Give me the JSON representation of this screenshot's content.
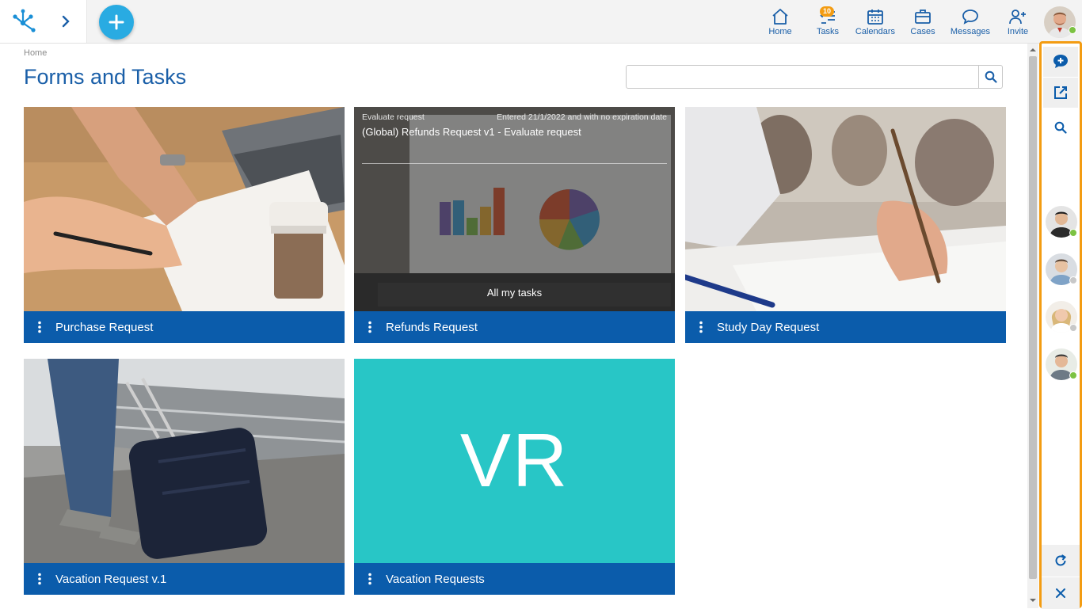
{
  "topbar": {
    "nav": [
      {
        "label": "Home",
        "icon": "home-icon"
      },
      {
        "label": "Tasks",
        "icon": "tasks-icon",
        "badge": "10"
      },
      {
        "label": "Calendars",
        "icon": "calendar-icon"
      },
      {
        "label": "Cases",
        "icon": "briefcase-icon"
      },
      {
        "label": "Messages",
        "icon": "message-icon"
      },
      {
        "label": "Invite",
        "icon": "invite-user-icon"
      }
    ],
    "user_status": "online"
  },
  "page": {
    "breadcrumb": "Home",
    "title": "Forms and Tasks",
    "search": {
      "value": "",
      "placeholder": ""
    }
  },
  "cards": [
    {
      "title": "Purchase Request",
      "image": "desk-coffee-photo"
    },
    {
      "title": "Refunds Request",
      "image": "laptop-charts-photo",
      "task": {
        "type": "Evaluate request",
        "entered": "Entered 21/1/2022 and with no expiration date",
        "name": "(Global) Refunds Request v1 - Evaluate request",
        "all_link": "All my tasks"
      }
    },
    {
      "title": "Study Day Request",
      "image": "exam-writing-photo"
    },
    {
      "title": "Vacation Request v.1",
      "image": "suitcase-travel-photo"
    },
    {
      "title": "Vacation Requests",
      "initials": "VR"
    }
  ],
  "colors": {
    "brand_blue": "#0b5cab",
    "title_blue": "#1a5fa8",
    "accent_cyan": "#29abe2",
    "vr_teal": "#28c6c6",
    "highlight_orange": "#f39c12",
    "online_green": "#7cc242",
    "offline_grey": "#c8c8c8"
  },
  "side_panel": {
    "actions": [
      "new-chat-icon",
      "open-external-icon",
      "search-icon"
    ],
    "contacts": [
      {
        "status": "online"
      },
      {
        "status": "offline"
      },
      {
        "status": "offline"
      },
      {
        "status": "online"
      }
    ],
    "footer": [
      "refresh-icon",
      "close-icon"
    ]
  }
}
